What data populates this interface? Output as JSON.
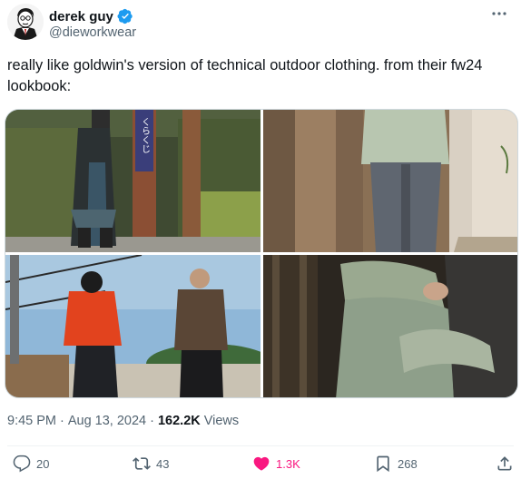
{
  "author": {
    "display_name": "derek guy",
    "handle": "@dieworkwear",
    "verified": true,
    "avatar_icon": "cartoon-portrait-avatar"
  },
  "tweet": {
    "text": "really like goldwin's version of technical outdoor clothing. from their fw24 lookbook:"
  },
  "media": {
    "photos": [
      {
        "name": "photo-train-platform"
      },
      {
        "name": "photo-wooden-wall"
      },
      {
        "name": "photo-red-jacket-coast"
      },
      {
        "name": "photo-seated-knees"
      }
    ],
    "sign_text": "くらくじ"
  },
  "meta": {
    "time": "9:45 PM",
    "sep1": "·",
    "date": "Aug 13, 2024",
    "sep2": "·",
    "views_count": "162.2K",
    "views_label": "Views"
  },
  "actions": {
    "replies": "20",
    "reposts": "43",
    "likes": "1.3K",
    "bookmarks": "268",
    "like_color": "#f91880"
  },
  "colors": {
    "text": "#0f1419",
    "secondary": "#536471",
    "verified_blue": "#1d9bf0"
  }
}
